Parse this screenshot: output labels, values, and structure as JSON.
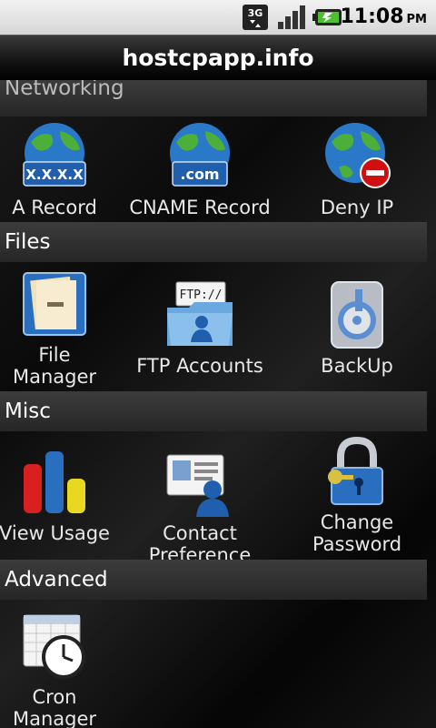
{
  "status": {
    "network": "3G",
    "time": "11:08",
    "ampm": "PM"
  },
  "title": "hostcpapp.info",
  "sections": [
    {
      "title": "Networking",
      "items": [
        {
          "label": "A Record",
          "badge": "X.X.X.X",
          "icon": "globe-icon"
        },
        {
          "label": "CNAME Record",
          "badge": ".com",
          "icon": "globe-icon"
        },
        {
          "label": "Deny IP",
          "icon": "globe-deny-icon"
        }
      ]
    },
    {
      "title": "Files",
      "items": [
        {
          "label_line1": "File",
          "label_line2": "Manager",
          "icon": "file-manager-icon"
        },
        {
          "label": "FTP Accounts",
          "badge": "FTP://",
          "icon": "ftp-folder-icon"
        },
        {
          "label": "BackUp",
          "icon": "backup-icon"
        }
      ]
    },
    {
      "title": "Misc",
      "items": [
        {
          "label": "View Usage",
          "icon": "bar-chart-icon"
        },
        {
          "label": "Contact Preference",
          "icon": "contact-card-icon"
        },
        {
          "label_line1": "Change",
          "label_line2": "Password",
          "icon": "padlock-icon"
        }
      ]
    },
    {
      "title": "Advanced",
      "items": [
        {
          "label_line1": "Cron",
          "label_line2": "Manager",
          "icon": "calendar-clock-icon"
        }
      ]
    }
  ],
  "colors": {
    "status_bar": "#e0e0e0",
    "section_header": "#333333",
    "label": "#e8e8e8",
    "globe_blue": "#2a78c8",
    "globe_green": "#4caf3a",
    "deny_red": "#d01010"
  }
}
